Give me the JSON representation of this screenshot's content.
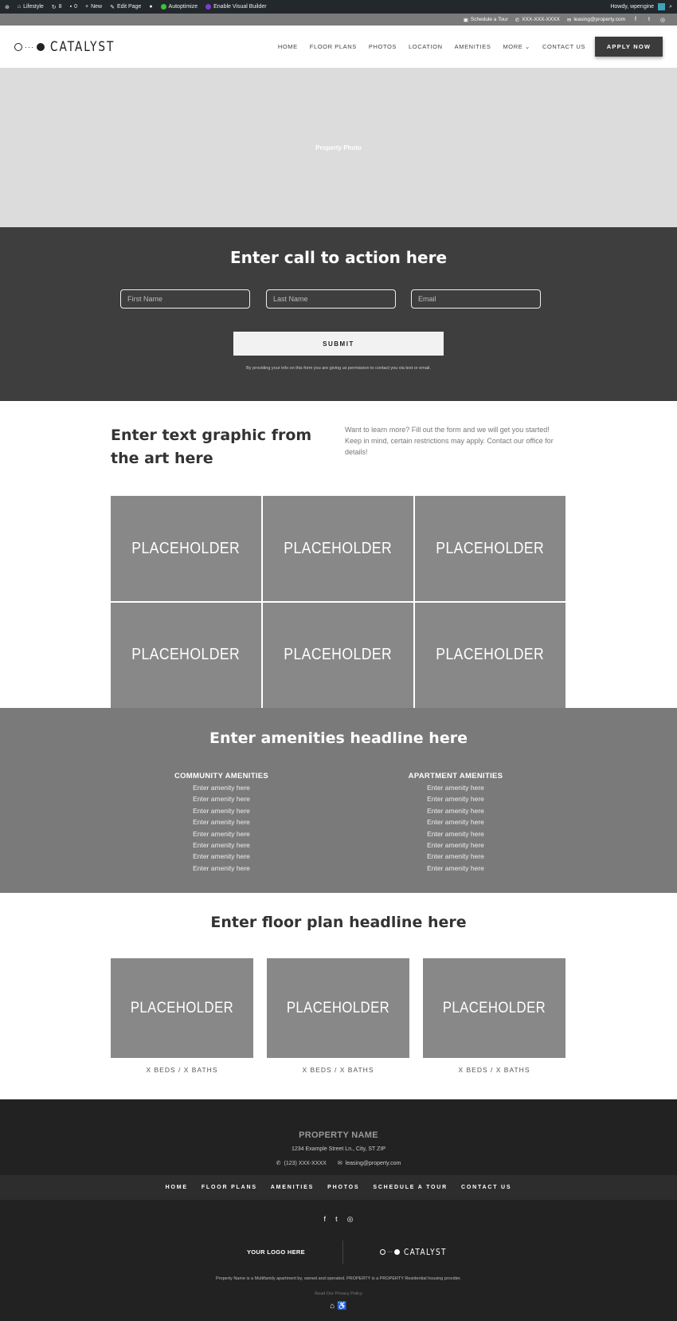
{
  "admin_bar": {
    "site_name": "Lifestyle",
    "updates_count": "8",
    "comments_count": "0",
    "new_label": "New",
    "edit_label": "Edit Page",
    "autoptimize_label": "Autoptimize",
    "visual_builder_label": "Enable Visual Builder",
    "greeting": "Howdy, wpengine"
  },
  "info_bar": {
    "tour_label": "Schedule a Tour",
    "phone": "XXX-XXX-XXXX",
    "email": "leasing@property.com"
  },
  "header": {
    "logo_text": "CATALYST",
    "nav": [
      "HOME",
      "FLOOR PLANS",
      "PHOTOS",
      "LOCATION",
      "AMENITIES",
      "MORE",
      "CONTACT US"
    ],
    "apply_label": "APPLY NOW"
  },
  "hero": {
    "label": "Property Photo"
  },
  "cta": {
    "title": "Enter call to action here",
    "first_name_placeholder": "First Name",
    "last_name_placeholder": "Last Name",
    "email_placeholder": "Email",
    "submit_label": "SUBMIT",
    "disclaimer": "By providing your info on this form you are giving us permission to contact you via text or email."
  },
  "intro": {
    "title": "Enter text graphic from the art here",
    "text": "Want to learn more? Fill out the form and we will get you started! Keep in mind, certain restrictions may apply. Contact our office for details!"
  },
  "gallery": {
    "tiles": [
      "PLACEHOLDER",
      "PLACEHOLDER",
      "PLACEHOLDER",
      "PLACEHOLDER",
      "PLACEHOLDER",
      "PLACEHOLDER"
    ]
  },
  "amenities": {
    "title": "Enter amenities headline here",
    "community_heading": "COMMUNITY AMENITIES",
    "apartment_heading": "APARTMENT AMENITIES",
    "community_items": [
      "Enter amenity here",
      "Enter amenity here",
      "Enter amenity here",
      "Enter amenity here",
      "Enter amenity here",
      "Enter amenity here",
      "Enter amenity here",
      "Enter amenity here"
    ],
    "apartment_items": [
      "Enter amenity here",
      "Enter amenity here",
      "Enter amenity here",
      "Enter amenity here",
      "Enter amenity here",
      "Enter amenity here",
      "Enter amenity here",
      "Enter amenity here"
    ]
  },
  "floor_plans": {
    "title": "Enter floor plan headline here",
    "cards": [
      {
        "image_label": "PLACEHOLDER",
        "caption": "X BEDS / X BATHS"
      },
      {
        "image_label": "PLACEHOLDER",
        "caption": "X BEDS / X BATHS"
      },
      {
        "image_label": "PLACEHOLDER",
        "caption": "X BEDS / X BATHS"
      }
    ]
  },
  "footer": {
    "property_name": "PROPERTY NAME",
    "address": "1234 Example Street Ln., City, ST ZIP",
    "phone": "(123) XXX-XXXX",
    "email": "leasing@property.com",
    "nav": [
      "HOME",
      "FLOOR PLANS",
      "AMENITIES",
      "PHOTOS",
      "SCHEDULE A TOUR",
      "CONTACT US"
    ],
    "your_logo": "YOUR LOGO HERE",
    "catalyst_logo": "CATALYST",
    "legal": "Property Name is a Multifamily apartment by, owned and operated. PROPERTY is a PROPERTY Residential housing provider.",
    "privacy": "Read Our Privacy Policy"
  },
  "colors": {
    "admin_bar": "#23282d",
    "info_bar": "#7a7a7a",
    "cta_bg": "#3e3e3e",
    "placeholder": "#888888",
    "amenities_bg": "#7a7a7a",
    "footer_bg": "#222222"
  },
  "icons": {
    "admin": [
      "wordpress-icon",
      "home-icon",
      "updates-icon",
      "comments-icon",
      "plus-icon",
      "pencil-icon",
      "circle-icon",
      "search-icon"
    ],
    "social": [
      "facebook-icon",
      "twitter-icon",
      "instagram-icon"
    ],
    "footer_badges": [
      "equal-housing-icon",
      "accessibility-icon"
    ]
  }
}
